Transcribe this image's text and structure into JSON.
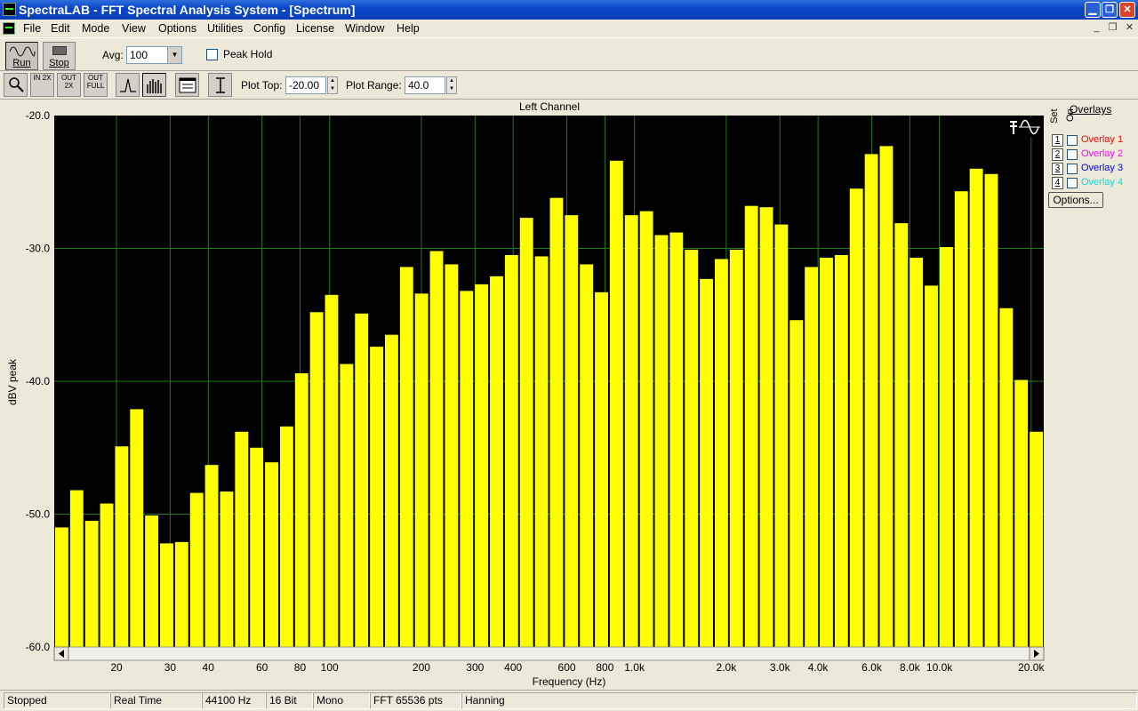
{
  "window": {
    "title": "SpectraLAB - FFT Spectral Analysis System - [Spectrum]",
    "min_glyph": "▁",
    "max_glyph": "❐",
    "close_glyph": "✕"
  },
  "menubar": {
    "items": [
      "File",
      "Edit",
      "Mode",
      "View",
      "Options",
      "Utilities",
      "Config",
      "License",
      "Window",
      "Help"
    ],
    "mdi_min": "_",
    "mdi_restore": "❐",
    "mdi_close": "✕"
  },
  "toolbar1": {
    "run_label": "Run",
    "stop_label": "Stop",
    "avg_label": "Avg:",
    "avg_value": "100",
    "peak_hold_label": "Peak Hold",
    "peak_hold_checked": false
  },
  "toolbar2": {
    "zoom_in_label": "IN 2X",
    "zoom_in2_label": "OUT 2X",
    "zoom_full_label": "OUT FULL",
    "plot_top_label": "Plot Top:",
    "plot_top_value": "-20.00",
    "plot_range_label": "Plot Range:",
    "plot_range_value": "40.0"
  },
  "overlays": {
    "header": "Overlays",
    "set_label": "Set",
    "on_label": "On",
    "items": [
      {
        "num": "1",
        "name": "Overlay 1",
        "color": "#ff0000",
        "checked": false
      },
      {
        "num": "2",
        "name": "Overlay 2",
        "color": "#ff00ff",
        "checked": false
      },
      {
        "num": "3",
        "name": "Overlay 3",
        "color": "#0000ff",
        "checked": false
      },
      {
        "num": "4",
        "name": "Overlay 4",
        "color": "#00ffff",
        "checked": false
      }
    ],
    "options_label": "Options..."
  },
  "statusbar": {
    "cells": [
      "Stopped",
      "Real Time",
      "44100 Hz",
      "16 Bit",
      "Mono",
      "FFT 65536 pts",
      "Hanning"
    ]
  },
  "colors": {
    "bar_fill": "#ffff00",
    "plot_bg": "#000000",
    "grid": "#1e7a1e"
  },
  "chart_data": {
    "type": "bar",
    "title": "Left Channel",
    "xlabel": "Frequency (Hz)",
    "ylabel": "dBV peak",
    "x_scale": "log",
    "xlim": [
      12.5,
      22000
    ],
    "ylim": [
      -60,
      -20
    ],
    "y_ticks": [
      "-20.0",
      "-30.0",
      "-40.0",
      "-50.0",
      "-60.0"
    ],
    "y_tick_values": [
      -20,
      -30,
      -40,
      -50,
      -60
    ],
    "x_ticks": [
      {
        "label": "20",
        "value": 20
      },
      {
        "label": "30",
        "value": 30
      },
      {
        "label": "40",
        "value": 40
      },
      {
        "label": "60",
        "value": 60
      },
      {
        "label": "80",
        "value": 80
      },
      {
        "label": "100",
        "value": 100
      },
      {
        "label": "200",
        "value": 200
      },
      {
        "label": "300",
        "value": 300
      },
      {
        "label": "400",
        "value": 400
      },
      {
        "label": "600",
        "value": 600
      },
      {
        "label": "800",
        "value": 800
      },
      {
        "label": "1.0k",
        "value": 1000
      },
      {
        "label": "2.0k",
        "value": 2000
      },
      {
        "label": "3.0k",
        "value": 3000
      },
      {
        "label": "4.0k",
        "value": 4000
      },
      {
        "label": "6.0k",
        "value": 6000
      },
      {
        "label": "8.0k",
        "value": 8000
      },
      {
        "label": "10.0k",
        "value": 10000
      },
      {
        "label": "20.0k",
        "value": 20000
      }
    ],
    "grid": true,
    "values": [
      -51.0,
      -48.2,
      -50.5,
      -49.2,
      -44.9,
      -42.1,
      -50.1,
      -52.2,
      -52.1,
      -48.4,
      -46.3,
      -48.3,
      -43.8,
      -45.0,
      -46.1,
      -43.4,
      -39.4,
      -34.8,
      -33.5,
      -38.7,
      -34.9,
      -37.4,
      -36.5,
      -31.4,
      -33.4,
      -30.2,
      -31.2,
      -33.2,
      -32.7,
      -32.1,
      -30.5,
      -27.7,
      -30.6,
      -26.2,
      -27.5,
      -31.2,
      -33.3,
      -23.4,
      -27.5,
      -27.2,
      -29.0,
      -28.8,
      -30.1,
      -32.3,
      -30.8,
      -30.1,
      -26.8,
      -26.9,
      -28.2,
      -35.4,
      -31.4,
      -30.7,
      -30.5,
      -25.5,
      -22.9,
      -22.3,
      -28.1,
      -30.7,
      -32.8,
      -29.9,
      -25.7,
      -24.0,
      -24.4,
      -34.5,
      -39.9,
      -43.8
    ]
  }
}
